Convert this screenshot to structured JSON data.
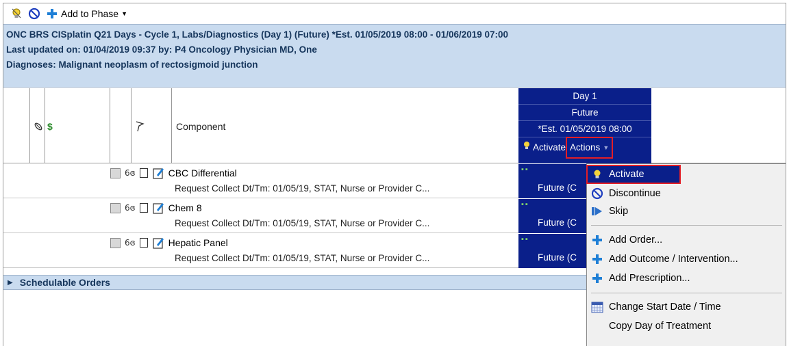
{
  "toolbar": {
    "add_phase_label": "Add to Phase",
    "icons": [
      "lightbulb-icon",
      "prohibit-icon",
      "plus-icon"
    ]
  },
  "header": {
    "line1": "ONC BRS CISplatin Q21 Days - Cycle 1, Labs/Diagnostics (Day 1) (Future) *Est. 01/05/2019 08:00 - 01/06/2019 07:00",
    "line2": "Last updated on: 01/04/2019 09:37   by: P4 Oncology Physician MD, One",
    "line3": "Diagnoses: Malignant neoplasm of rectosigmoid junction"
  },
  "columns": {
    "dollar": "$",
    "component": "Component"
  },
  "day_column": {
    "day": "Day 1",
    "status": "Future",
    "est": "*Est. 01/05/2019 08:00",
    "activate": "Activate",
    "actions": "Actions"
  },
  "orders": [
    {
      "name": "CBC Differential",
      "detail": "Request Collect Dt/Tm: 01/05/19, STAT, Nurse or Provider C...",
      "status": "Future (C"
    },
    {
      "name": "Chem 8",
      "detail": "Request Collect Dt/Tm: 01/05/19, STAT, Nurse or Provider C...",
      "status": "Future (C"
    },
    {
      "name": "Hepatic Panel",
      "detail": "Request Collect Dt/Tm: 01/05/19, STAT, Nurse or Provider C...",
      "status": "Future (C"
    }
  ],
  "schedulable_label": "Schedulable Orders",
  "menu": {
    "items": [
      {
        "label": "Activate",
        "icon": "lightbulb-icon"
      },
      {
        "label": "Discontinue",
        "icon": "prohibit-icon"
      },
      {
        "label": "Skip",
        "icon": "skip-icon"
      },
      {
        "label": "Add Order...",
        "icon": "plus-icon"
      },
      {
        "label": "Add Outcome / Intervention...",
        "icon": "plus-icon"
      },
      {
        "label": "Add Prescription...",
        "icon": "plus-icon"
      },
      {
        "label": "Change Start Date / Time",
        "icon": "calendar-icon"
      },
      {
        "label": "Copy Day of Treatment",
        "icon": ""
      }
    ]
  },
  "colors": {
    "header_band": "#c9dbef",
    "day_column": "#0a1f8a",
    "highlight_border": "#e41e26",
    "plus_blue": "#1e7fd6"
  }
}
